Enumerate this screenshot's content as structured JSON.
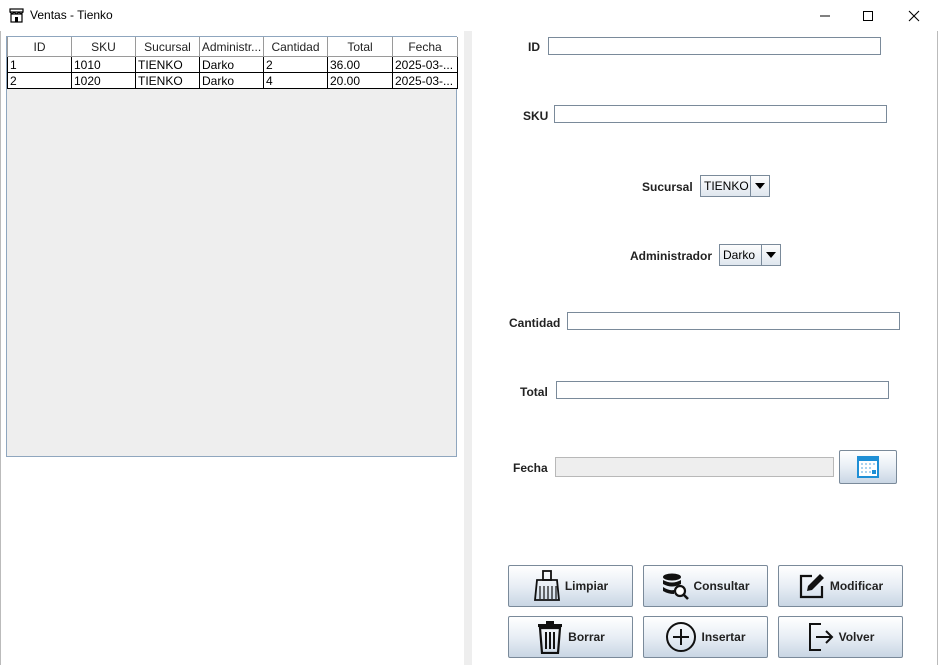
{
  "window": {
    "title": "Ventas - Tienko",
    "app_icon": "store-icon",
    "controls": {
      "minimize": "minimize-icon",
      "maximize": "maximize-icon",
      "close": "close-icon"
    }
  },
  "table": {
    "columns": [
      "ID",
      "SKU",
      "Sucursal",
      "Administr...",
      "Cantidad",
      "Total",
      "Fecha"
    ],
    "rows": [
      [
        "1",
        "1010",
        "TIENKO",
        "Darko",
        "2",
        "36.00",
        "2025-03-..."
      ],
      [
        "2",
        "1020",
        "TIENKO",
        "Darko",
        "4",
        "20.00",
        "2025-03-..."
      ]
    ]
  },
  "form": {
    "id_label": "ID",
    "id_value": "",
    "sku_label": "SKU",
    "sku_value": "",
    "sucursal_label": "Sucursal",
    "sucursal_value": "TIENKO",
    "administrador_label": "Administrador",
    "administrador_value": "Darko",
    "cantidad_label": "Cantidad",
    "cantidad_value": "",
    "total_label": "Total",
    "total_value": "",
    "fecha_label": "Fecha",
    "fecha_value": "",
    "calendar_icon": "calendar-icon"
  },
  "buttons": {
    "limpiar": "Limpiar",
    "consultar": "Consultar",
    "modificar": "Modificar",
    "borrar": "Borrar",
    "insertar": "Insertar",
    "volver": "Volver"
  },
  "colors": {
    "accent_blue": "#1e8fd6",
    "button_border": "#7a8a9a"
  }
}
